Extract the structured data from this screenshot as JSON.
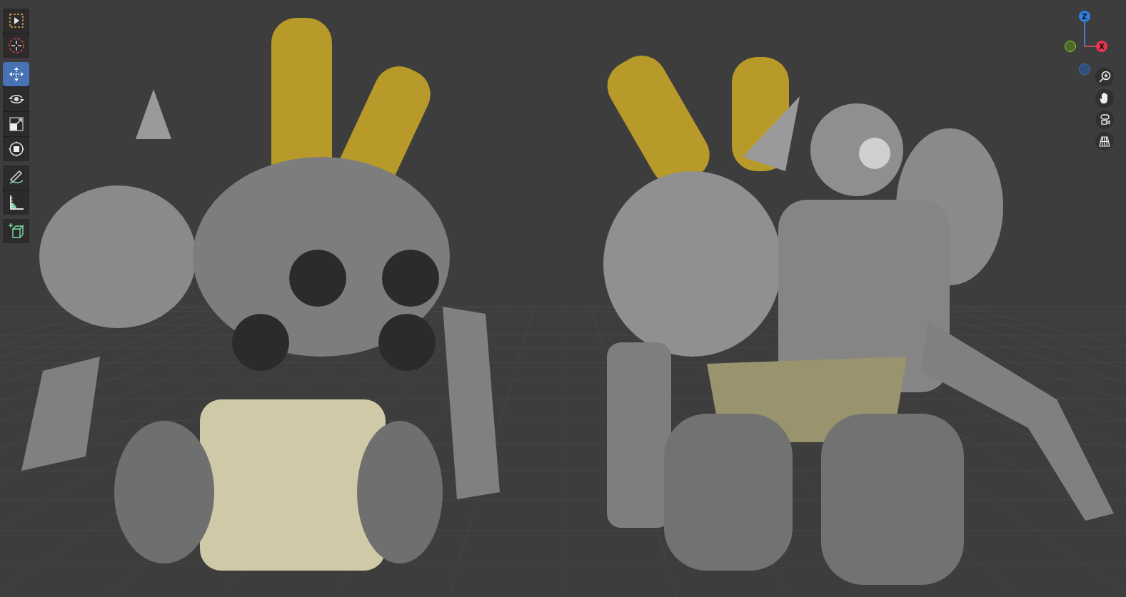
{
  "toolbar": {
    "groups": [
      [
        {
          "kind": "select-box",
          "selected": false
        },
        {
          "kind": "cursor",
          "selected": false
        }
      ],
      [
        {
          "kind": "move",
          "selected": true
        },
        {
          "kind": "rotate",
          "selected": false
        },
        {
          "kind": "scale",
          "selected": false
        },
        {
          "kind": "transform",
          "selected": false
        }
      ],
      [
        {
          "kind": "annotate",
          "selected": false
        },
        {
          "kind": "measure",
          "selected": false
        }
      ],
      [
        {
          "kind": "add-cube",
          "selected": false
        }
      ]
    ]
  },
  "gizmo": {
    "z_label": "Z",
    "x_label": "X"
  },
  "navigation": [
    {
      "kind": "zoom"
    },
    {
      "kind": "pan"
    },
    {
      "kind": "camera"
    },
    {
      "kind": "grid"
    }
  ]
}
